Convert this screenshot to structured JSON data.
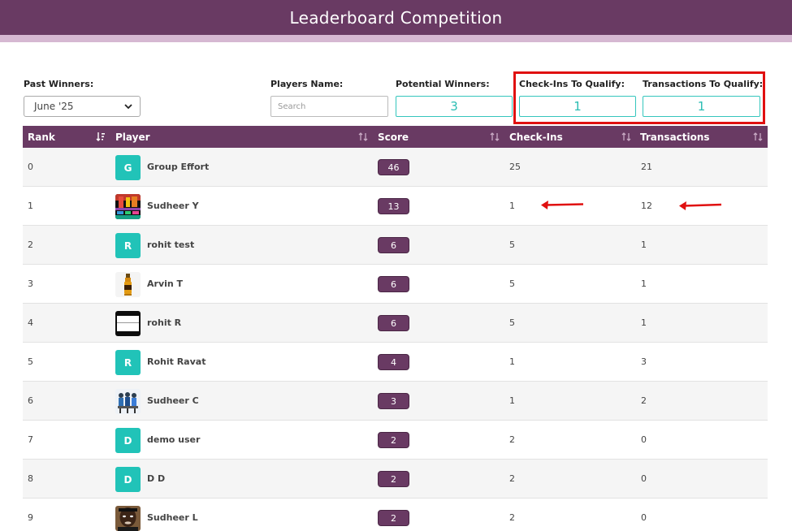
{
  "header": {
    "title": "Leaderboard Competition"
  },
  "filters": {
    "past_winners_label": "Past Winners:",
    "past_winners_value": "June '25",
    "players_name_label": "Players Name:",
    "search_placeholder": "Search",
    "potential_winners_label": "Potential Winners:",
    "potential_winners_value": "3",
    "checkins_label": "Check-Ins To Qualify:",
    "checkins_value": "1",
    "transactions_label": "Transactions To Qualify:",
    "transactions_value": "1"
  },
  "table": {
    "columns": [
      "Rank",
      "Player",
      "Score",
      "Check-Ins",
      "Transactions"
    ],
    "rows": [
      {
        "rank": "0",
        "avatar": "G",
        "avatar_type": "letter",
        "name": "Group Effort",
        "score": "46",
        "checkins": "25",
        "transactions": "21"
      },
      {
        "rank": "1",
        "avatar": "",
        "avatar_type": "photo-colorful",
        "name": "Sudheer Y",
        "score": "13",
        "checkins": "1",
        "transactions": "12"
      },
      {
        "rank": "2",
        "avatar": "R",
        "avatar_type": "letter",
        "name": "rohit test",
        "score": "6",
        "checkins": "5",
        "transactions": "1"
      },
      {
        "rank": "3",
        "avatar": "",
        "avatar_type": "photo-bottle",
        "name": "Arvin T",
        "score": "6",
        "checkins": "5",
        "transactions": "1"
      },
      {
        "rank": "4",
        "avatar": "",
        "avatar_type": "photo-dark-frame",
        "name": "rohit R",
        "score": "6",
        "checkins": "5",
        "transactions": "1"
      },
      {
        "rank": "5",
        "avatar": "R",
        "avatar_type": "letter",
        "name": "Rohit Ravat",
        "score": "4",
        "checkins": "1",
        "transactions": "3"
      },
      {
        "rank": "6",
        "avatar": "",
        "avatar_type": "photo-group",
        "name": "Sudheer C",
        "score": "3",
        "checkins": "1",
        "transactions": "2"
      },
      {
        "rank": "7",
        "avatar": "D",
        "avatar_type": "letter",
        "name": "demo user",
        "score": "2",
        "checkins": "2",
        "transactions": "0"
      },
      {
        "rank": "8",
        "avatar": "D",
        "avatar_type": "letter",
        "name": "D D",
        "score": "2",
        "checkins": "2",
        "transactions": "0"
      },
      {
        "rank": "9",
        "avatar": "",
        "avatar_type": "photo-face",
        "name": "Sudheer L",
        "score": "2",
        "checkins": "2",
        "transactions": "0"
      }
    ]
  },
  "colors": {
    "header_purple": "#693a63",
    "accent_teal": "#21c3b8",
    "highlight_red": "#e01010"
  },
  "icons": [
    "chevron-down-icon",
    "sort-icon",
    "sort-descending-icon",
    "arrow-annotation-icon"
  ]
}
